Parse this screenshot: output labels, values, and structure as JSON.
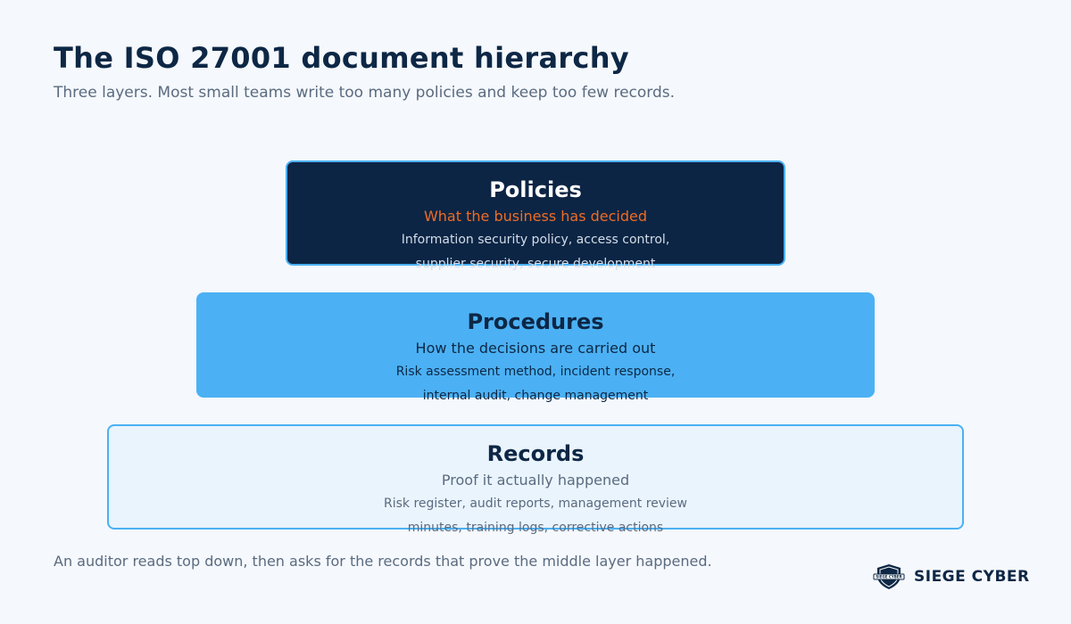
{
  "title": "The ISO 27001 document hierarchy",
  "subtitle": "Three layers. Most small teams write too many policies and keep too few records.",
  "layers": [
    {
      "name": "Policies",
      "description": "What the business has decided",
      "examples_line1": "Information security policy, access control,",
      "examples_line2": "supplier security, secure development"
    },
    {
      "name": "Procedures",
      "description": "How the decisions are carried out",
      "examples_line1": "Risk assessment method, incident response,",
      "examples_line2": "internal audit, change management"
    },
    {
      "name": "Records",
      "description": "Proof it actually happened",
      "examples_line1": "Risk register, audit reports, management review",
      "examples_line2": "minutes, training logs, corrective actions"
    }
  ],
  "footer": "An auditor reads top down, then asks for the records that prove the middle layer happened.",
  "brand": {
    "name": "SIEGE CYBER",
    "emblem_text": "SIEGE CYBER",
    "icon": "shield-logo-icon"
  },
  "colors": {
    "background": "#f5f8fc",
    "navy": "#0d2745",
    "accent_blue": "#4bb1f4",
    "light_blue": "#eaf4fd",
    "orange": "#ef6c24",
    "muted_text": "#5a6b80"
  }
}
